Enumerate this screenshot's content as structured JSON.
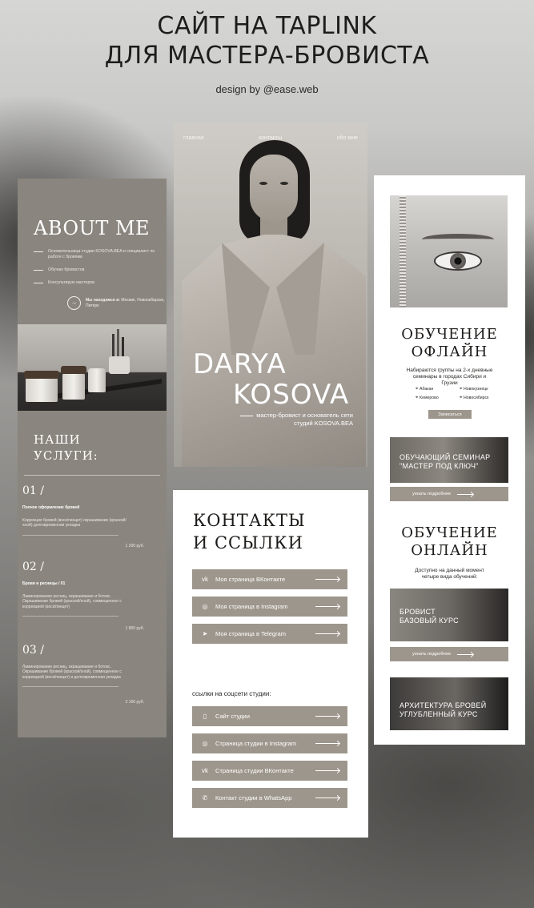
{
  "header": {
    "title_line1": "САЙТ НА TAPLINK",
    "title_line2": "ДЛЯ МАСТЕРА-БРОВИСТА",
    "credit": "design by @ease.web"
  },
  "about": {
    "title": "ABOUT ME",
    "items": [
      "Основательница студии KOSOVA.BEA и специалист по работе с бровями",
      "Обучаю бровистов",
      "Консультирую мастеров"
    ],
    "location_label": "Мы находимся в:",
    "location_text": "Москве, Новосибирске, Питере"
  },
  "services": {
    "title_line1": "НАШИ",
    "title_line2": "УСЛУГИ:",
    "items": [
      {
        "num": "01 /",
        "name": "Полное оформление бровей",
        "desc": "Коррекция бровей (воск/пинцет) окрашивание (краской/хной) долговременная укладка",
        "price": "1 200 руб."
      },
      {
        "num": "02 /",
        "name": "Брови и ресницы / 01",
        "desc": "Ламинирование ресниц, окрашивание и ботокс. Окрашивание бровей (краской/хной), совмещенное с коррекцией (воск/пинцет)",
        "price": "1 800 руб."
      },
      {
        "num": "03 /",
        "name": "",
        "desc": "Ламинирование ресниц, окрашивание и ботокс. Окрашивание бровей (краской/хной), совмещенное с коррекцией (воск/пинцет) и долговременная укладка",
        "price": "2 100 руб."
      }
    ]
  },
  "hero": {
    "nav": [
      "главная",
      "контакты",
      "обо мне"
    ],
    "name_line1": "DARYA",
    "name_line2": "KOSOVA",
    "subtitle": "мастер-бровист и основатель сети студий KOSOVA.BEA"
  },
  "contacts": {
    "title_line1": "КОНТАКТЫ",
    "title_line2": "И ССЫЛКИ",
    "personal": [
      {
        "icon": "vk-icon",
        "label": "Моя страница ВКонтакте"
      },
      {
        "icon": "instagram-icon",
        "label": "Моя страница в Instagram"
      },
      {
        "icon": "telegram-icon",
        "label": "Моя страница в Telegram"
      }
    ],
    "studio_label": "ссылки на соцсети студии:",
    "studio": [
      {
        "icon": "site-icon",
        "label": "Сайт студии"
      },
      {
        "icon": "instagram-icon",
        "label": "Страница студии в Instagram"
      },
      {
        "icon": "vk-icon",
        "label": "Страница студии ВКонтакте"
      },
      {
        "icon": "whatsapp-icon",
        "label": "Контакт студии в WhatsApp"
      }
    ]
  },
  "courses": {
    "offline_title_1": "ОБУЧЕНИЕ",
    "offline_title_2": "ОФЛАЙН",
    "offline_note": "Набираются группы на 2-х дневные семинары в городах Сибири и Грузии",
    "cities": [
      "Абакан",
      "Новокузнецк",
      "Кемерово",
      "Новосибирск"
    ],
    "signup": "Записаться",
    "seminar_line1": "ОБУЧАЮЩИЙ СЕМИНАР",
    "seminar_line2": "\"МАСТЕР ПОД КЛЮЧ\"",
    "more": "узнать подробнее",
    "online_title_1": "ОБУЧЕНИЕ",
    "online_title_2": "ОНЛАЙН",
    "online_note": "Доступно на данный момент четыре вида обучений:",
    "course1_line1": "БРОВИСТ",
    "course1_line2": "БАЗОВЫЙ КУРС",
    "course2_line1": "АРХИТЕКТУРА БРОВЕЙ",
    "course2_line2": "УГЛУБЛЕННЫЙ КУРС"
  },
  "colors": {
    "accent": "#9d968c",
    "card_bg": "#8a857e"
  }
}
